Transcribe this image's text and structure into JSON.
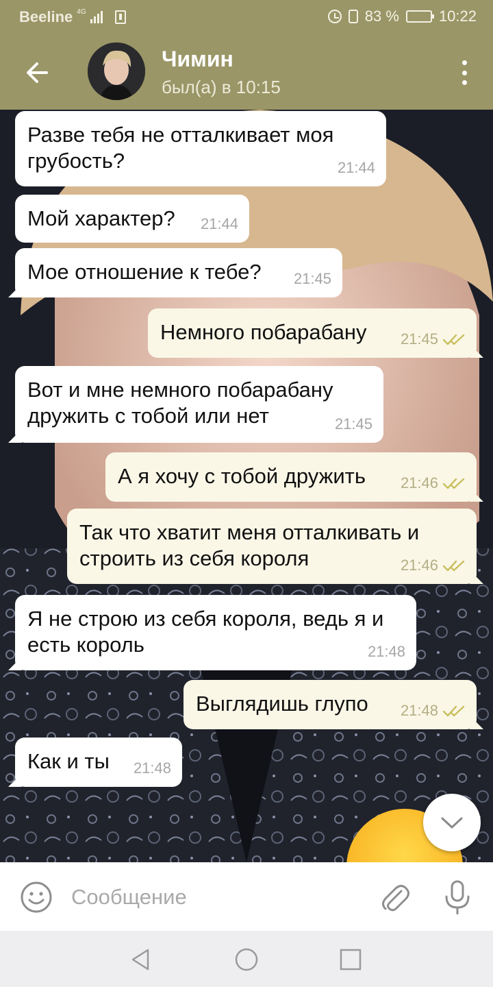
{
  "status_bar": {
    "carrier": "Beeline",
    "network": "4G",
    "battery": "83 %",
    "battery_level": 0.83,
    "time": "10:22"
  },
  "header": {
    "name": "Чимин",
    "status": "был(а) в 10:15"
  },
  "messages": [
    {
      "direction": "in",
      "text": "Разве тебя не отталкивает моя грубость?",
      "time": "21:44"
    },
    {
      "direction": "in",
      "text": "Мой характер?",
      "time": "21:44"
    },
    {
      "direction": "in",
      "text": "Мое отношение к тебе?",
      "time": "21:45"
    },
    {
      "direction": "out",
      "text": "Немного побарабану",
      "time": "21:45",
      "read": true
    },
    {
      "direction": "in",
      "text": "Вот и мне немного побарабану дружить с тобой или нет",
      "time": "21:45"
    },
    {
      "direction": "out",
      "text": "А я хочу с тобой дружить",
      "time": "21:46",
      "read": true
    },
    {
      "direction": "out",
      "text": "Так что хватит меня отталкивать и строить из себя короля",
      "time": "21:46",
      "read": true
    },
    {
      "direction": "in",
      "text": "Я не строю из себя короля, ведь я и есть король",
      "time": "21:48"
    },
    {
      "direction": "out",
      "text": "Выглядишь глупо",
      "time": "21:48",
      "read": true
    },
    {
      "direction": "in",
      "text": "Как и ты",
      "time": "21:48"
    }
  ],
  "input": {
    "placeholder": "Сообщение"
  },
  "colors": {
    "header": "#9a9667",
    "incoming_bubble": "#ffffff",
    "outgoing_bubble": "#faf7e7",
    "read_ticks": "#c9bf5e"
  },
  "icons": {
    "back": "arrow-left-icon",
    "menu": "more-vertical-icon",
    "scroll_down": "chevron-down-icon",
    "emoji": "smile-icon",
    "attach": "paperclip-icon",
    "mic": "microphone-icon"
  }
}
